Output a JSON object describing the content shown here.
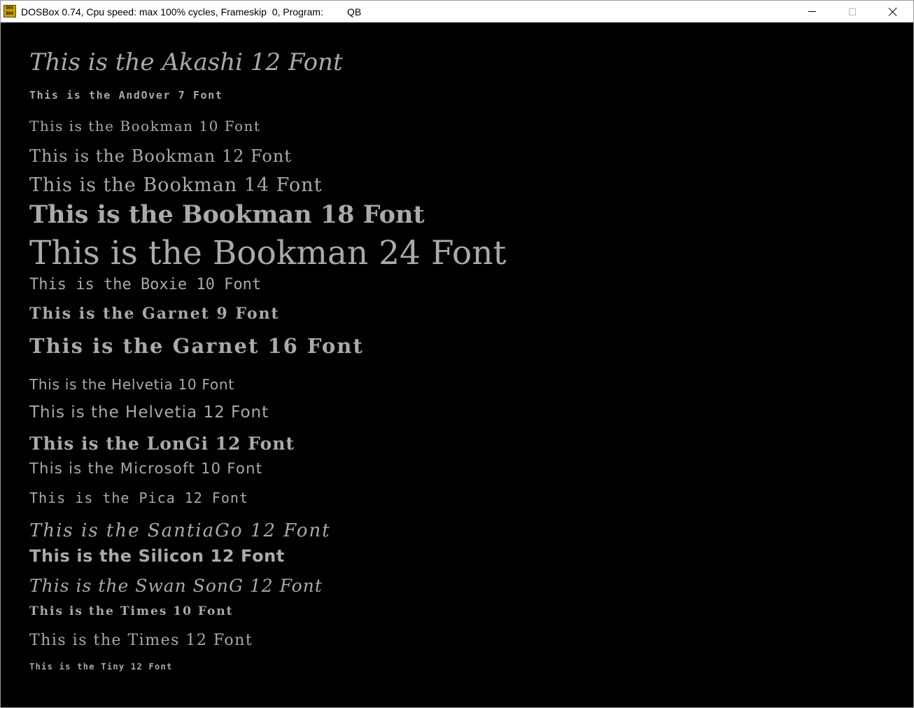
{
  "window": {
    "title": "DOSBox 0.74, Cpu speed: max 100% cycles, Frameskip  0, Program:",
    "program": "QB",
    "icon_text_top": "DOS",
    "icon_text_bottom": "BOX",
    "minimize_icon": "minimize-icon",
    "maximize_icon": "maximize-icon",
    "close_icon": "close-icon"
  },
  "screen": {
    "background": "#000000",
    "text_color": "#aaaaaa",
    "lines": [
      {
        "id": "akashi-12",
        "text": "This is the Akashi 12 Font"
      },
      {
        "id": "andover-7",
        "text": "This is the AndOver 7 Font"
      },
      {
        "id": "bookman-10",
        "text": "This is the Bookman 10 Font"
      },
      {
        "id": "bookman-12",
        "text": "This is the Bookman 12 Font"
      },
      {
        "id": "bookman-14",
        "text": "This is the Bookman 14 Font"
      },
      {
        "id": "bookman-18",
        "text": "This is the Bookman 18 Font"
      },
      {
        "id": "bookman-24",
        "text": "This is the Bookman 24 Font"
      },
      {
        "id": "boxie-10",
        "text": "This is the Boxie 10 Font"
      },
      {
        "id": "garnet-9",
        "text": "This is the Garnet 9 Font"
      },
      {
        "id": "garnet-16",
        "text": "This is the Garnet 16 Font"
      },
      {
        "id": "helvetia-10",
        "text": "This is the Helvetia 10 Font"
      },
      {
        "id": "helvetia-12",
        "text": "This is the Helvetia 12 Font"
      },
      {
        "id": "longi-12",
        "text": "This is the LonGi 12 Font"
      },
      {
        "id": "microsoft-10",
        "text": "This is the Microsoft 10 Font"
      },
      {
        "id": "pica-12",
        "text": "This is the Pica 12 Font"
      },
      {
        "id": "santiago-12",
        "text": "This is the SantiaGo 12 Font"
      },
      {
        "id": "silicon-12",
        "text": "This is the Silicon 12 Font"
      },
      {
        "id": "swansong-12",
        "text": "This is the Swan SonG 12 Font"
      },
      {
        "id": "times-10",
        "text": "This is the Times 10 Font"
      },
      {
        "id": "times-12",
        "text": "This is the Times 12 Font"
      },
      {
        "id": "tiny-12",
        "text": "This is the Tiny 12 Font"
      }
    ]
  }
}
